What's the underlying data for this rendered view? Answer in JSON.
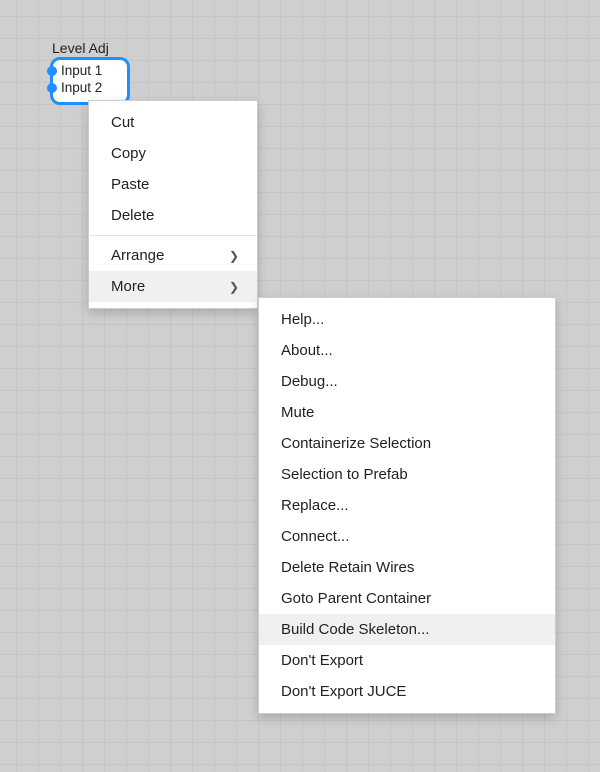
{
  "node": {
    "title": "Level Adj",
    "ports": [
      "Input 1",
      "Input 2"
    ]
  },
  "menu1": {
    "items": [
      {
        "label": "Cut",
        "submenu": false,
        "hover": false
      },
      {
        "label": "Copy",
        "submenu": false,
        "hover": false
      },
      {
        "label": "Paste",
        "submenu": false,
        "hover": false
      },
      {
        "label": "Delete",
        "submenu": false,
        "hover": false
      },
      {
        "sep": true
      },
      {
        "label": "Arrange",
        "submenu": true,
        "hover": false
      },
      {
        "label": "More",
        "submenu": true,
        "hover": true
      }
    ]
  },
  "menu2": {
    "items": [
      {
        "label": "Help...",
        "hover": false
      },
      {
        "label": "About...",
        "hover": false
      },
      {
        "label": "Debug...",
        "hover": false
      },
      {
        "label": "Mute",
        "hover": false
      },
      {
        "label": "Containerize Selection",
        "hover": false
      },
      {
        "label": "Selection to Prefab",
        "hover": false
      },
      {
        "label": "Replace...",
        "hover": false
      },
      {
        "label": "Connect...",
        "hover": false
      },
      {
        "label": "Delete Retain Wires",
        "hover": false
      },
      {
        "label": "Goto Parent Container",
        "hover": false
      },
      {
        "label": "Build Code Skeleton...",
        "hover": true
      },
      {
        "label": "Don't Export",
        "hover": false
      },
      {
        "label": "Don't Export JUCE",
        "hover": false
      }
    ]
  },
  "glyphs": {
    "chevron_right": "❯"
  }
}
